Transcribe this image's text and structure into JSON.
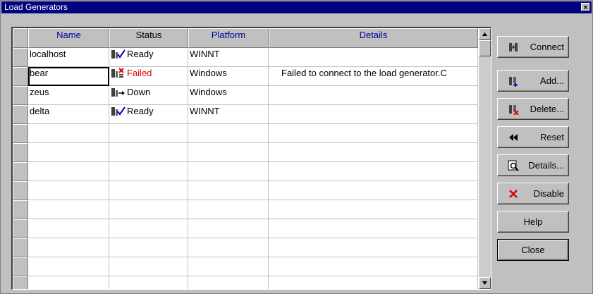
{
  "window": {
    "title": "Load Generators"
  },
  "grid": {
    "columns": [
      "Name",
      "Status",
      "Platform",
      "Details"
    ],
    "rows": [
      {
        "name": "localhost",
        "status": "Ready",
        "status_icon": "ready-icon",
        "platform": "WINNT",
        "details": ""
      },
      {
        "name": "bear",
        "status": "Failed",
        "status_icon": "failed-icon",
        "platform": "Windows",
        "details": "Failed to connect to the load generator.C"
      },
      {
        "name": "zeus",
        "status": "Down",
        "status_icon": "down-icon",
        "platform": "Windows",
        "details": ""
      },
      {
        "name": "delta",
        "status": "Ready",
        "status_icon": "ready-icon",
        "platform": "WINNT",
        "details": ""
      }
    ],
    "empty_row_count": 9
  },
  "buttons": {
    "connect": "Connect",
    "add": "Add...",
    "delete": "Delete...",
    "reset": "Reset",
    "details": "Details...",
    "disable": "Disable",
    "help": "Help",
    "close": "Close"
  },
  "colors": {
    "title_bar": "#000080",
    "header_text": "#0000a0",
    "failed_text": "#e00000",
    "face": "#c0c0c0"
  }
}
